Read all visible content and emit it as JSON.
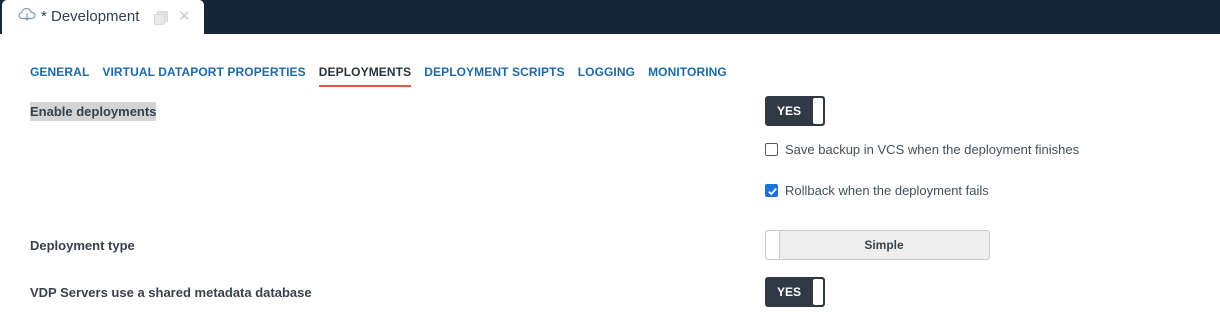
{
  "document_tab": {
    "icon": "cloud-icon",
    "title": "* Development"
  },
  "nav": {
    "tabs": [
      {
        "label": "GENERAL"
      },
      {
        "label": "VIRTUAL DATAPORT PROPERTIES"
      },
      {
        "label": "DEPLOYMENTS"
      },
      {
        "label": "DEPLOYMENT SCRIPTS"
      },
      {
        "label": "LOGGING"
      },
      {
        "label": "MONITORING"
      }
    ],
    "active": "DEPLOYMENTS"
  },
  "form": {
    "enable_deployments": {
      "label": "Enable deployments",
      "value": "YES"
    },
    "save_backup": {
      "label": "Save backup in VCS when the deployment finishes",
      "checked": false
    },
    "rollback": {
      "label": "Rollback when the deployment fails",
      "checked": true
    },
    "deployment_type": {
      "label": "Deployment type",
      "value": "Simple"
    },
    "shared_metadata": {
      "label": "VDP Servers use a shared metadata database",
      "value": "YES"
    }
  },
  "colors": {
    "topbar": "#18263a",
    "link": "#1c6aa8",
    "active_underline": "#e8563f",
    "toggle_on": "#2f3a45",
    "checkbox_on": "#1a73d9"
  }
}
